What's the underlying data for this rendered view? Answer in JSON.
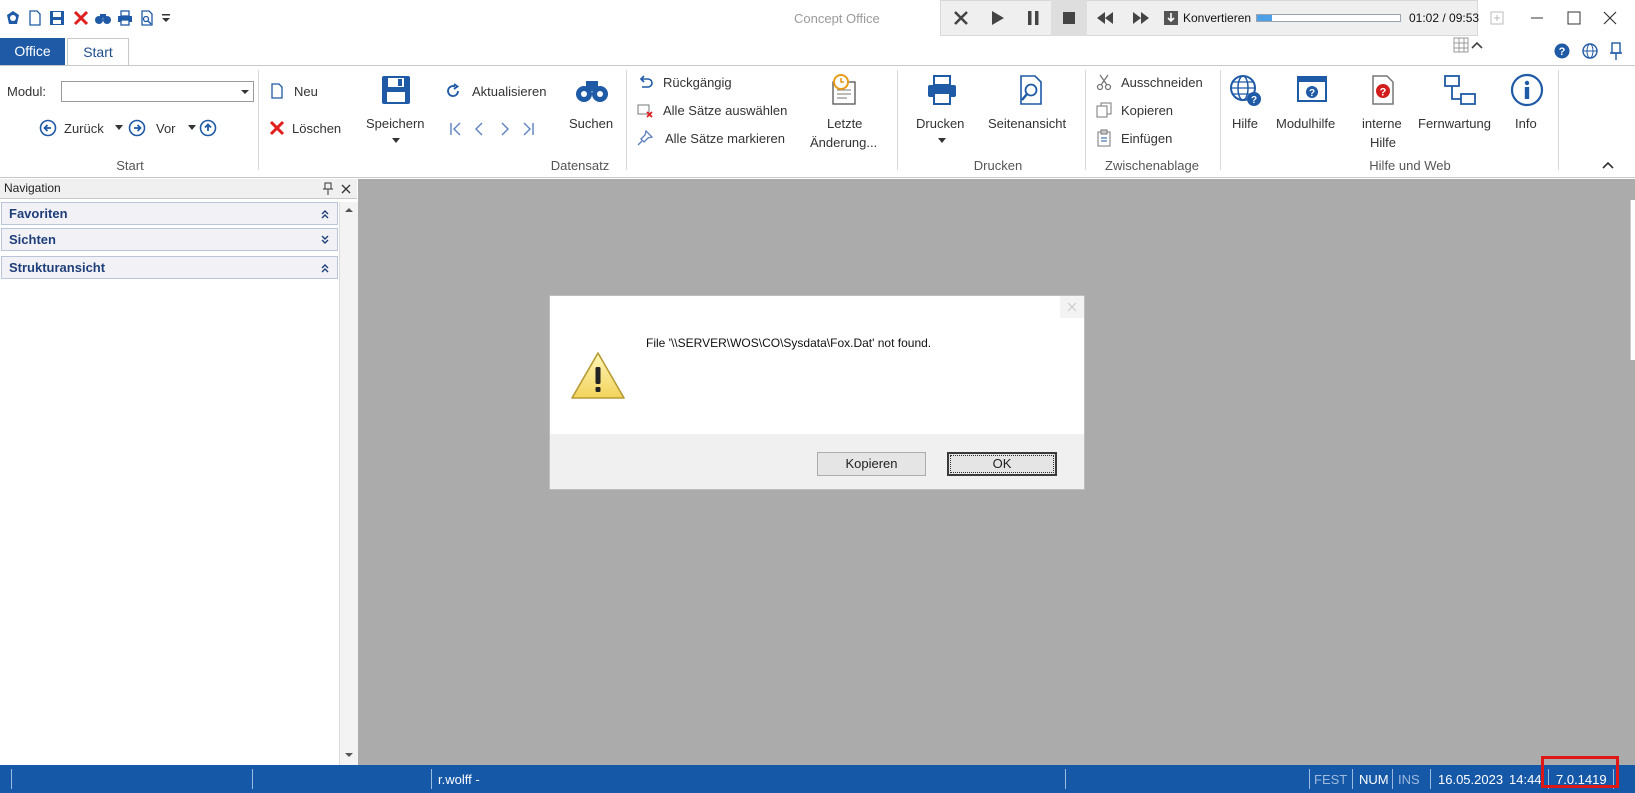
{
  "window": {
    "title": "Concept Office",
    "media_player": {
      "convert_label": "Konvertieren",
      "time": "01:02 / 09:53",
      "progress_fraction": 0.107
    }
  },
  "tabs": {
    "office": "Office",
    "start": "Start"
  },
  "ribbon": {
    "start_group": {
      "modul_label": "Modul:",
      "modul_value": "",
      "back": "Zurück",
      "forward": "Vor",
      "group_label": "Start"
    },
    "datensatz": {
      "neu": "Neu",
      "loeschen": "Löschen",
      "speichern": "Speichern",
      "aktualisieren": "Aktualisieren",
      "suchen": "Suchen",
      "rueckgaengig": "Rückgängig",
      "alle_auswaehlen": "Alle Sätze auswählen",
      "alle_markieren": "Alle Sätze markieren",
      "letzte_1": "Letzte",
      "letzte_2": "Änderung...",
      "group_label": "Datensatz"
    },
    "drucken": {
      "drucken": "Drucken",
      "seitenansicht": "Seitenansicht",
      "group_label": "Drucken"
    },
    "zwischenablage": {
      "ausschneiden": "Ausschneiden",
      "kopieren": "Kopieren",
      "einfuegen": "Einfügen",
      "group_label": "Zwischenablage"
    },
    "hilfe": {
      "hilfe": "Hilfe",
      "modulhilfe": "Modulhilfe",
      "interne_1": "interne",
      "interne_2": "Hilfe",
      "fernwartung": "Fernwartung",
      "info": "Info",
      "group_label": "Hilfe und Web"
    }
  },
  "navigation": {
    "title": "Navigation",
    "sections": [
      "Favoriten",
      "Sichten",
      "Strukturansicht"
    ]
  },
  "dialog": {
    "message": "File '\\\\SERVER\\WOS\\CO\\Sysdata\\Fox.Dat' not found.",
    "copy_button": "Kopieren",
    "ok_button": "OK"
  },
  "status": {
    "user": "r.wolff -",
    "fest": "FEST",
    "num": "NUM",
    "ins": "INS",
    "date": "16.05.2023",
    "time": "14:44",
    "version": "7.0.1419"
  }
}
